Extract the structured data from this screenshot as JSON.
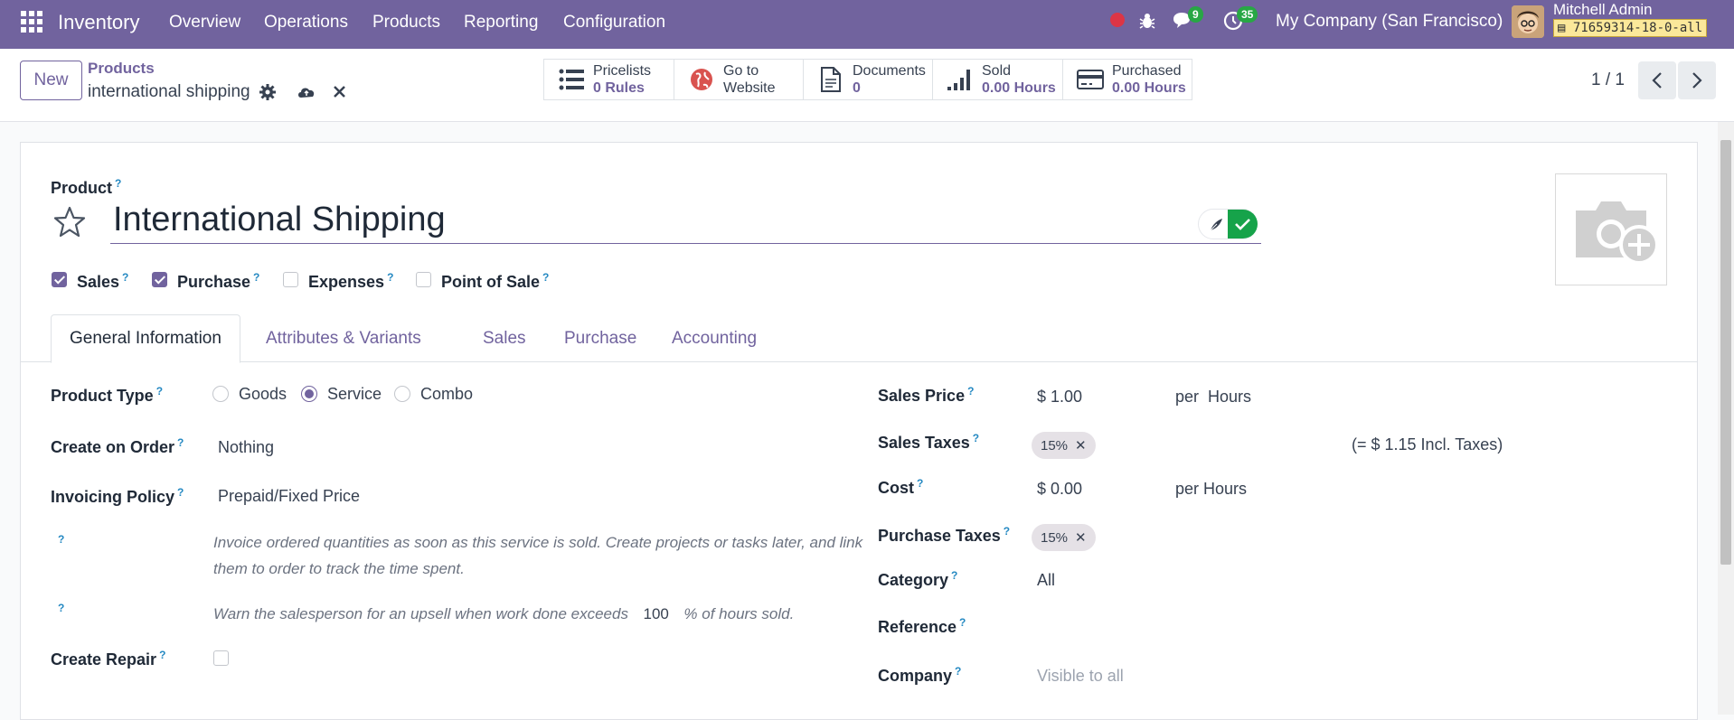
{
  "topbar": {
    "app_name": "Inventory",
    "menus": [
      "Overview",
      "Operations",
      "Products",
      "Reporting",
      "Configuration"
    ],
    "messages_count": "9",
    "activities_count": "35",
    "company": "My Company (San Francisco)",
    "user_name": "Mitchell Admin",
    "db_name": "71659314-18-0-all"
  },
  "control": {
    "new_label": "New",
    "breadcrumb": "Products",
    "record_title": "international shipping",
    "smart_buttons": [
      {
        "title": "Pricelists",
        "value": "0 Rules"
      },
      {
        "title": "Go to",
        "value": "Website"
      },
      {
        "title": "Documents",
        "value": "0"
      },
      {
        "title": "Sold",
        "value": "0.00 Hours"
      },
      {
        "title": "Purchased",
        "value": "0.00 Hours"
      }
    ],
    "pager": "1 / 1"
  },
  "form": {
    "product_label": "Product",
    "name": "International Shipping",
    "checkboxes": [
      {
        "label": "Sales",
        "checked": true
      },
      {
        "label": "Purchase",
        "checked": true
      },
      {
        "label": "Expenses",
        "checked": false
      },
      {
        "label": "Point of Sale",
        "checked": false
      }
    ],
    "tabs": [
      "General Information",
      "Attributes & Variants",
      "Sales",
      "Purchase",
      "Accounting"
    ],
    "left": {
      "product_type_label": "Product Type",
      "product_type_options": [
        "Goods",
        "Service",
        "Combo"
      ],
      "product_type_selected": "Service",
      "create_on_order_label": "Create on Order",
      "create_on_order_value": "Nothing",
      "invoicing_policy_label": "Invoicing Policy",
      "invoicing_policy_value": "Prepaid/Fixed Price",
      "invoice_help": "Invoice ordered quantities as soon as this service is sold. Create projects or tasks later, and link them to order to track the time spent.",
      "upsell_prefix": "Warn the salesperson for an upsell when work done exceeds",
      "upsell_value": "100",
      "upsell_suffix": "% of hours sold.",
      "create_repair_label": "Create Repair"
    },
    "right": {
      "sales_price_label": "Sales Price",
      "sales_price_value": "$ 1.00",
      "sales_price_unit": "per  Hours",
      "sales_taxes_label": "Sales Taxes",
      "sales_taxes_tag": "15%",
      "sales_taxes_incl": "(= $ 1.15 Incl. Taxes)",
      "cost_label": "Cost",
      "cost_value": "$ 0.00",
      "cost_unit": "per Hours",
      "purchase_taxes_label": "Purchase Taxes",
      "purchase_taxes_tag": "15%",
      "category_label": "Category",
      "category_value": "All",
      "reference_label": "Reference",
      "company_label": "Company",
      "company_placeholder": "Visible to all"
    }
  },
  "colors": {
    "brand": "#71639e",
    "badge": "#28a745",
    "help_link": "#2589c2"
  }
}
